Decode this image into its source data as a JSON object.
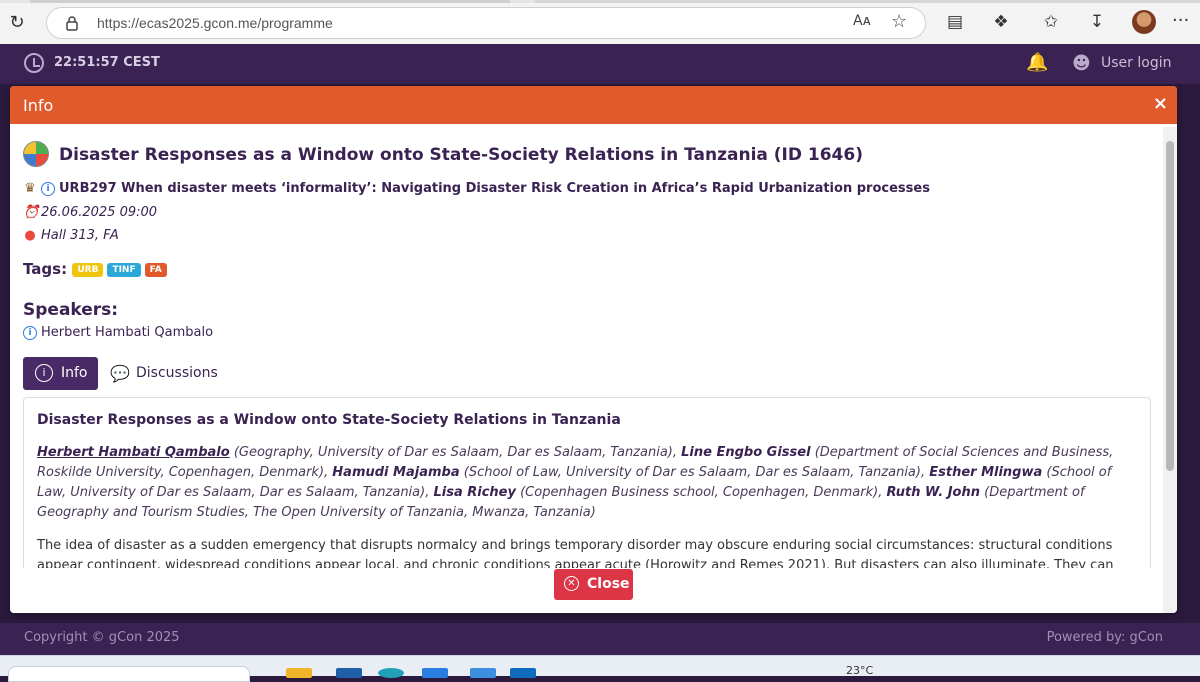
{
  "browser": {
    "url": "https://ecas2025.gcon.me/programme",
    "read_aloud": "Aᴀ",
    "icons": [
      "reload-icon",
      "lock-icon",
      "read-aloud-icon",
      "favorite-star-icon",
      "collections-icon",
      "extensions-icon",
      "favorites-icon",
      "downloads-icon",
      "profile-avatar",
      "more-menu-icon"
    ]
  },
  "header": {
    "time": "22:51:57  CEST",
    "user_login": "User login"
  },
  "modal": {
    "title": "Info",
    "close_x": "×",
    "paper_title": "Disaster Responses as a Window onto State-Society Relations in Tanzania (ID 1646)",
    "session": "URB297 When disaster meets ‘informality’: Navigating Disaster Risk Creation in Africa’s Rapid Urbanization processes",
    "date": "26.06.2025 09:00",
    "location": "Hall 313, FA",
    "tags_label": "Tags:",
    "tags": [
      {
        "label": "URB",
        "color": "#f1c40f"
      },
      {
        "label": "TINF",
        "color": "#2aa8d8"
      },
      {
        "label": "FA",
        "color": "#e05a2b"
      }
    ],
    "speakers_label": "Speakers:",
    "speaker": "Herbert Hambati Qambalo",
    "tabs": {
      "info": "Info",
      "discussions": "Discussions"
    },
    "card": {
      "title": "Disaster Responses as a Window onto State-Society Relations in Tanzania",
      "authors": [
        {
          "name": "Herbert Hambati Qambalo",
          "affil": " (Geography, University of Dar es Salaam, Dar es Salaam, Tanzania), "
        },
        {
          "name": "Line Engbo Gissel",
          "affil": " (Department of Social Sciences and Business, Roskilde University, Copenhagen, Denmark), "
        },
        {
          "name": "Hamudi Majamba",
          "affil": " (School of Law, University of Dar es Salaam, Dar es Salaam, Tanzania), "
        },
        {
          "name": "Esther Mlingwa",
          "affil": " (School of Law, University of Dar es Salaam, Dar es Salaam, Tanzania), "
        },
        {
          "name": "Lisa Richey",
          "affil": " (Copenhagen Business school, Copenhagen, Denmark), "
        },
        {
          "name": "Ruth W. John",
          "affil": " (Department of Geography and Tourism Studies, The Open University of Tanzania, Mwanza, Tanzania)"
        }
      ],
      "abstract": "The idea of disaster as a sudden emergency that disrupts normalcy and brings temporary disorder may obscure enduring social circumstances: structural conditions appear contingent, widespread conditions appear local, and chronic conditions appear acute (Horowitz and Remes 2021). But disasters can also illuminate. They can ‘reveal a society’s true"
    },
    "close_button": "Close"
  },
  "footer": {
    "copyright": "Copyright © gCon 2025",
    "powered": "Powered by:  gCon"
  },
  "taskbar": {
    "weather": "23°C"
  }
}
